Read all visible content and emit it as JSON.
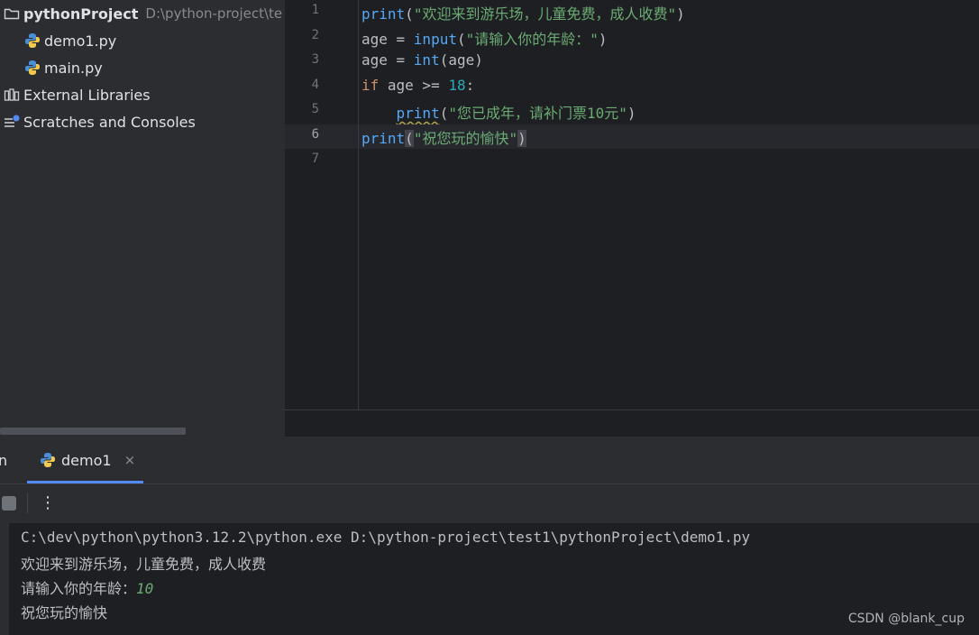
{
  "project_tree": {
    "root_name": "pythonProject",
    "root_path": "D:\\python-project\\te",
    "files": [
      "demo1.py",
      "main.py"
    ],
    "external_libraries": "External Libraries",
    "scratches": "Scratches and Consoles"
  },
  "editor": {
    "current_line": 6,
    "lines": [
      {
        "no": "1",
        "tokens": [
          {
            "t": "print",
            "k": "fn"
          },
          {
            "t": "(",
            "k": "p"
          },
          {
            "t": "\"欢迎来到游乐场，儿童免费，成人收费\"",
            "k": "str"
          },
          {
            "t": ")",
            "k": "p"
          }
        ]
      },
      {
        "no": "2",
        "tokens": [
          {
            "t": "age = ",
            "k": "p"
          },
          {
            "t": "input",
            "k": "fn"
          },
          {
            "t": "(",
            "k": "p"
          },
          {
            "t": "\"请输入你的年龄：\"",
            "k": "str"
          },
          {
            "t": ")",
            "k": "p"
          }
        ]
      },
      {
        "no": "3",
        "tokens": [
          {
            "t": "age = ",
            "k": "p"
          },
          {
            "t": "int",
            "k": "fn"
          },
          {
            "t": "(age)",
            "k": "p"
          }
        ]
      },
      {
        "no": "4",
        "tokens": [
          {
            "t": "if",
            "k": "kw"
          },
          {
            "t": " age >= ",
            "k": "p"
          },
          {
            "t": "18",
            "k": "num"
          },
          {
            "t": ":",
            "k": "p"
          }
        ]
      },
      {
        "no": "5",
        "tokens": [
          {
            "t": "    ",
            "k": "p"
          },
          {
            "t": "print",
            "k": "fn-squiggle"
          },
          {
            "t": "(",
            "k": "p"
          },
          {
            "t": "\"您已成年，请补门票10元\"",
            "k": "str"
          },
          {
            "t": ")",
            "k": "p"
          }
        ]
      },
      {
        "no": "6",
        "tokens": [
          {
            "t": "print",
            "k": "fn"
          },
          {
            "t": "(",
            "k": "brace"
          },
          {
            "t": "\"祝您玩的愉快\"",
            "k": "str"
          },
          {
            "t": ")",
            "k": "brace"
          }
        ]
      },
      {
        "no": "7",
        "tokens": []
      }
    ]
  },
  "run_panel": {
    "cut_tab_label": "n",
    "tab_label": "demo1",
    "close_glyph": "×",
    "more_glyph": "⋮",
    "console": {
      "command": "C:\\dev\\python\\python3.12.2\\python.exe D:\\python-project\\test1\\pythonProject\\demo1.py",
      "output1": "欢迎来到游乐场，儿童免费，成人收费",
      "prompt": "请输入你的年龄：",
      "user_input": "10",
      "output2": "祝您玩的愉快"
    }
  },
  "watermark": "CSDN @blank_cup",
  "colors": {
    "editor_bg": "#1e1f22",
    "panel_bg": "#2b2d30",
    "function": "#56a8f5",
    "keyword": "#cf8e6d",
    "string": "#6aab73",
    "number": "#2aacb8",
    "accent": "#548af7"
  }
}
